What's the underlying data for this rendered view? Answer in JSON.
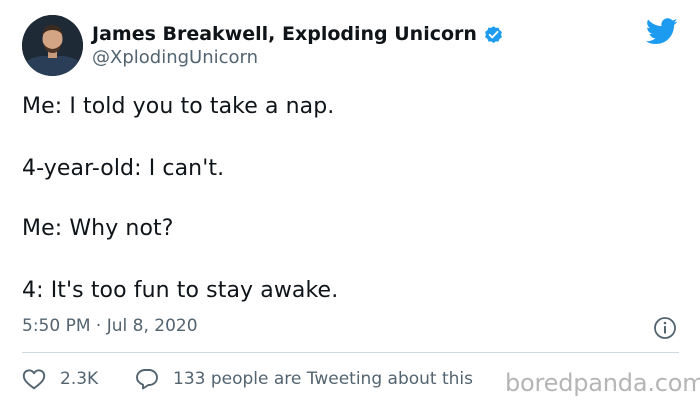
{
  "author": {
    "display_name": "James Breakwell, Exploding Unicorn",
    "handle": "@XplodingUnicorn",
    "verified": true,
    "avatar_icon": "profile-photo"
  },
  "tweet": {
    "lines": [
      "Me: I told you to take a nap.",
      "4-year-old: I can't.",
      "Me: Why not?",
      "4: It's too fun to stay awake."
    ],
    "timestamp": "5:50 PM · Jul 8, 2020"
  },
  "actions": {
    "likes": "2.3K",
    "conversation": "133 people are Tweeting about this"
  },
  "watermark": "boredpanda.com",
  "colors": {
    "twitter_blue": "#1d9bf0",
    "text": "#0f1419",
    "secondary_text": "#536471",
    "divider": "#cfd9de"
  }
}
